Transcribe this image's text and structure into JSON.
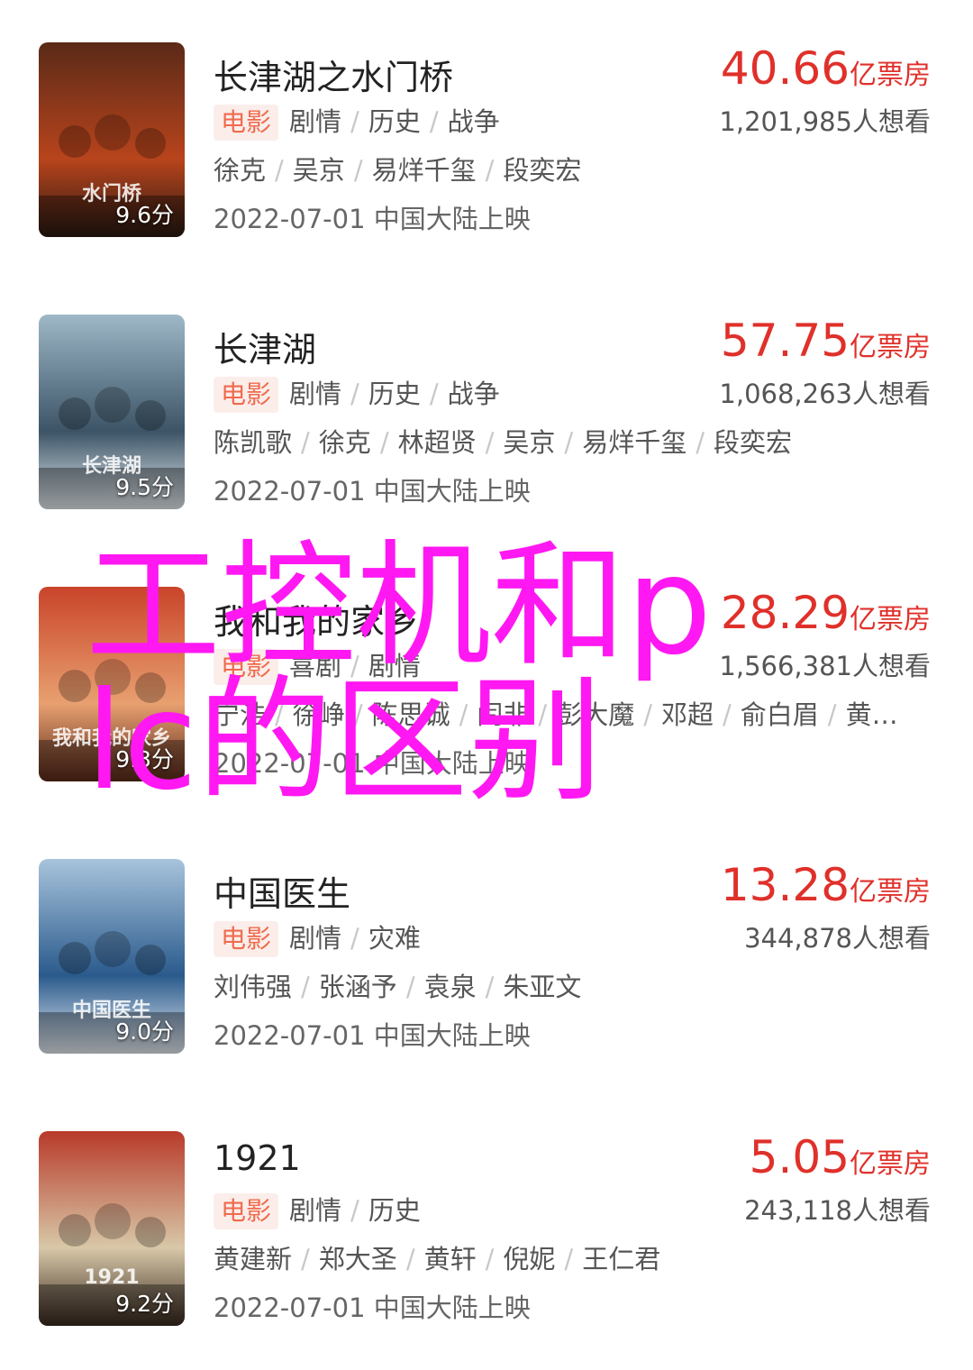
{
  "movies": [
    {
      "title": "长津湖之水门桥",
      "score": "9.6分",
      "category": "电影",
      "genres": [
        "剧情",
        "历史",
        "战争"
      ],
      "cast": [
        "徐克",
        "吴京",
        "易烊千玺",
        "段奕宏"
      ],
      "release": "2022-07-01 中国大陆上映",
      "box_number": "40.66",
      "box_unit": "亿票房",
      "want": "1,201,985人想看",
      "poster_colors": [
        "#5a2a18",
        "#b8441c",
        "#2a1a12"
      ],
      "poster_text": "水门桥"
    },
    {
      "title": "长津湖",
      "score": "9.5分",
      "category": "电影",
      "genres": [
        "剧情",
        "历史",
        "战争"
      ],
      "cast": [
        "陈凯歌",
        "徐克",
        "林超贤",
        "吴京",
        "易烊千玺",
        "段奕宏"
      ],
      "release": "2022-07-01 中国大陆上映",
      "box_number": "57.75",
      "box_unit": "亿票房",
      "want": "1,068,263人想看",
      "poster_colors": [
        "#9eb8c8",
        "#3c5466",
        "#e8eef2"
      ],
      "poster_text": "长津湖"
    },
    {
      "title": "我和我的家乡",
      "score": "9.3分",
      "category": "电影",
      "genres": [
        "喜剧",
        "剧情"
      ],
      "cast": [
        "宁浩",
        "徐峥",
        "陈思诚",
        "闫非",
        "彭大魔",
        "邓超",
        "俞白眉",
        "黄…"
      ],
      "release": "2022-07-01 中国大陆上映",
      "box_number": "28.29",
      "box_unit": "亿票房",
      "want": "1,566,381人想看",
      "poster_colors": [
        "#c9442a",
        "#e8a070",
        "#5a2a1a"
      ],
      "poster_text": "我和我的家乡"
    },
    {
      "title": "中国医生",
      "score": "9.0分",
      "category": "电影",
      "genres": [
        "剧情",
        "灾难"
      ],
      "cast": [
        "刘伟强",
        "张涵予",
        "袁泉",
        "朱亚文"
      ],
      "release": "2022-07-01 中国大陆上映",
      "box_number": "13.28",
      "box_unit": "亿票房",
      "want": "344,878人想看",
      "poster_colors": [
        "#a8c4dc",
        "#2a5a8c",
        "#e8eef4"
      ],
      "poster_text": "中国医生"
    },
    {
      "title": "1921",
      "score": "9.2分",
      "category": "电影",
      "genres": [
        "剧情",
        "历史"
      ],
      "cast": [
        "黄建新",
        "郑大圣",
        "黄轩",
        "倪妮",
        "王仁君"
      ],
      "release": "2022-07-01 中国大陆上映",
      "box_number": "5.05",
      "box_unit": "亿票房",
      "want": "243,118人想看",
      "poster_colors": [
        "#b83a2a",
        "#d8c8a8",
        "#3a2a20"
      ],
      "poster_text": "1921"
    }
  ],
  "watermark": [
    "工控机和p",
    "lc的区别"
  ],
  "colors": {
    "accent_red": "#e0302a",
    "badge_bg": "#fbeeea",
    "badge_text": "#ef6b4f",
    "watermark": "#ff18f2"
  }
}
